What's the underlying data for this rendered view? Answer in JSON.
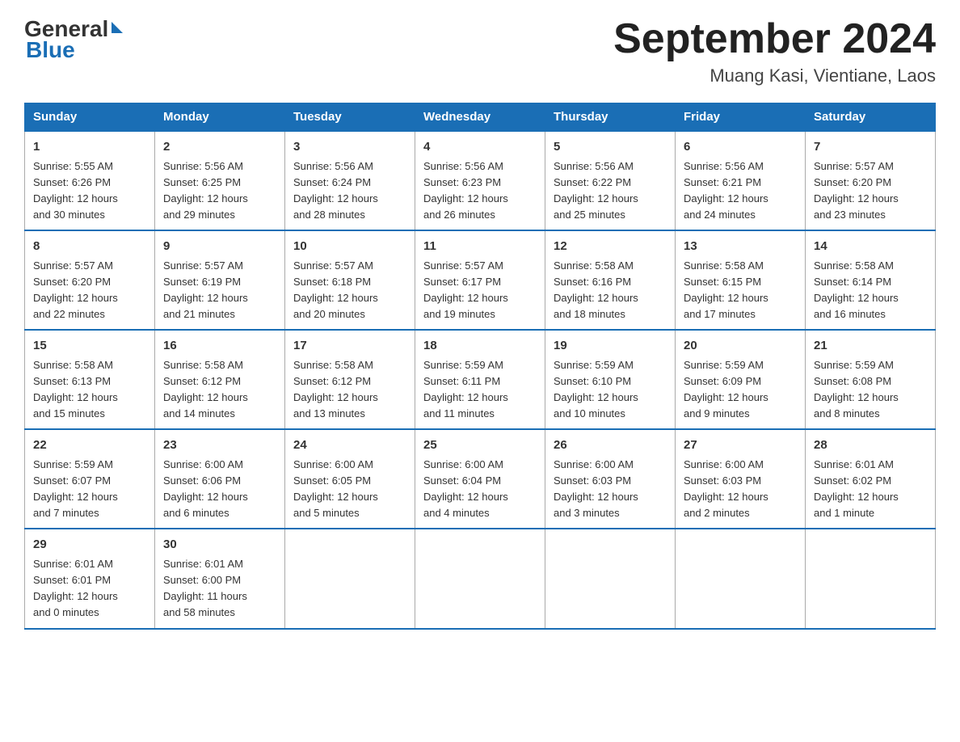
{
  "logo": {
    "general": "General",
    "blue": "Blue"
  },
  "title": "September 2024",
  "subtitle": "Muang Kasi, Vientiane, Laos",
  "days_of_week": [
    "Sunday",
    "Monday",
    "Tuesday",
    "Wednesday",
    "Thursday",
    "Friday",
    "Saturday"
  ],
  "weeks": [
    [
      {
        "day": "1",
        "sunrise": "5:55 AM",
        "sunset": "6:26 PM",
        "daylight": "12 hours and 30 minutes."
      },
      {
        "day": "2",
        "sunrise": "5:56 AM",
        "sunset": "6:25 PM",
        "daylight": "12 hours and 29 minutes."
      },
      {
        "day": "3",
        "sunrise": "5:56 AM",
        "sunset": "6:24 PM",
        "daylight": "12 hours and 28 minutes."
      },
      {
        "day": "4",
        "sunrise": "5:56 AM",
        "sunset": "6:23 PM",
        "daylight": "12 hours and 26 minutes."
      },
      {
        "day": "5",
        "sunrise": "5:56 AM",
        "sunset": "6:22 PM",
        "daylight": "12 hours and 25 minutes."
      },
      {
        "day": "6",
        "sunrise": "5:56 AM",
        "sunset": "6:21 PM",
        "daylight": "12 hours and 24 minutes."
      },
      {
        "day": "7",
        "sunrise": "5:57 AM",
        "sunset": "6:20 PM",
        "daylight": "12 hours and 23 minutes."
      }
    ],
    [
      {
        "day": "8",
        "sunrise": "5:57 AM",
        "sunset": "6:20 PM",
        "daylight": "12 hours and 22 minutes."
      },
      {
        "day": "9",
        "sunrise": "5:57 AM",
        "sunset": "6:19 PM",
        "daylight": "12 hours and 21 minutes."
      },
      {
        "day": "10",
        "sunrise": "5:57 AM",
        "sunset": "6:18 PM",
        "daylight": "12 hours and 20 minutes."
      },
      {
        "day": "11",
        "sunrise": "5:57 AM",
        "sunset": "6:17 PM",
        "daylight": "12 hours and 19 minutes."
      },
      {
        "day": "12",
        "sunrise": "5:58 AM",
        "sunset": "6:16 PM",
        "daylight": "12 hours and 18 minutes."
      },
      {
        "day": "13",
        "sunrise": "5:58 AM",
        "sunset": "6:15 PM",
        "daylight": "12 hours and 17 minutes."
      },
      {
        "day": "14",
        "sunrise": "5:58 AM",
        "sunset": "6:14 PM",
        "daylight": "12 hours and 16 minutes."
      }
    ],
    [
      {
        "day": "15",
        "sunrise": "5:58 AM",
        "sunset": "6:13 PM",
        "daylight": "12 hours and 15 minutes."
      },
      {
        "day": "16",
        "sunrise": "5:58 AM",
        "sunset": "6:12 PM",
        "daylight": "12 hours and 14 minutes."
      },
      {
        "day": "17",
        "sunrise": "5:58 AM",
        "sunset": "6:12 PM",
        "daylight": "12 hours and 13 minutes."
      },
      {
        "day": "18",
        "sunrise": "5:59 AM",
        "sunset": "6:11 PM",
        "daylight": "12 hours and 11 minutes."
      },
      {
        "day": "19",
        "sunrise": "5:59 AM",
        "sunset": "6:10 PM",
        "daylight": "12 hours and 10 minutes."
      },
      {
        "day": "20",
        "sunrise": "5:59 AM",
        "sunset": "6:09 PM",
        "daylight": "12 hours and 9 minutes."
      },
      {
        "day": "21",
        "sunrise": "5:59 AM",
        "sunset": "6:08 PM",
        "daylight": "12 hours and 8 minutes."
      }
    ],
    [
      {
        "day": "22",
        "sunrise": "5:59 AM",
        "sunset": "6:07 PM",
        "daylight": "12 hours and 7 minutes."
      },
      {
        "day": "23",
        "sunrise": "6:00 AM",
        "sunset": "6:06 PM",
        "daylight": "12 hours and 6 minutes."
      },
      {
        "day": "24",
        "sunrise": "6:00 AM",
        "sunset": "6:05 PM",
        "daylight": "12 hours and 5 minutes."
      },
      {
        "day": "25",
        "sunrise": "6:00 AM",
        "sunset": "6:04 PM",
        "daylight": "12 hours and 4 minutes."
      },
      {
        "day": "26",
        "sunrise": "6:00 AM",
        "sunset": "6:03 PM",
        "daylight": "12 hours and 3 minutes."
      },
      {
        "day": "27",
        "sunrise": "6:00 AM",
        "sunset": "6:03 PM",
        "daylight": "12 hours and 2 minutes."
      },
      {
        "day": "28",
        "sunrise": "6:01 AM",
        "sunset": "6:02 PM",
        "daylight": "12 hours and 1 minute."
      }
    ],
    [
      {
        "day": "29",
        "sunrise": "6:01 AM",
        "sunset": "6:01 PM",
        "daylight": "12 hours and 0 minutes."
      },
      {
        "day": "30",
        "sunrise": "6:01 AM",
        "sunset": "6:00 PM",
        "daylight": "11 hours and 58 minutes."
      },
      null,
      null,
      null,
      null,
      null
    ]
  ],
  "labels": {
    "sunrise": "Sunrise:",
    "sunset": "Sunset:",
    "daylight": "Daylight:"
  }
}
